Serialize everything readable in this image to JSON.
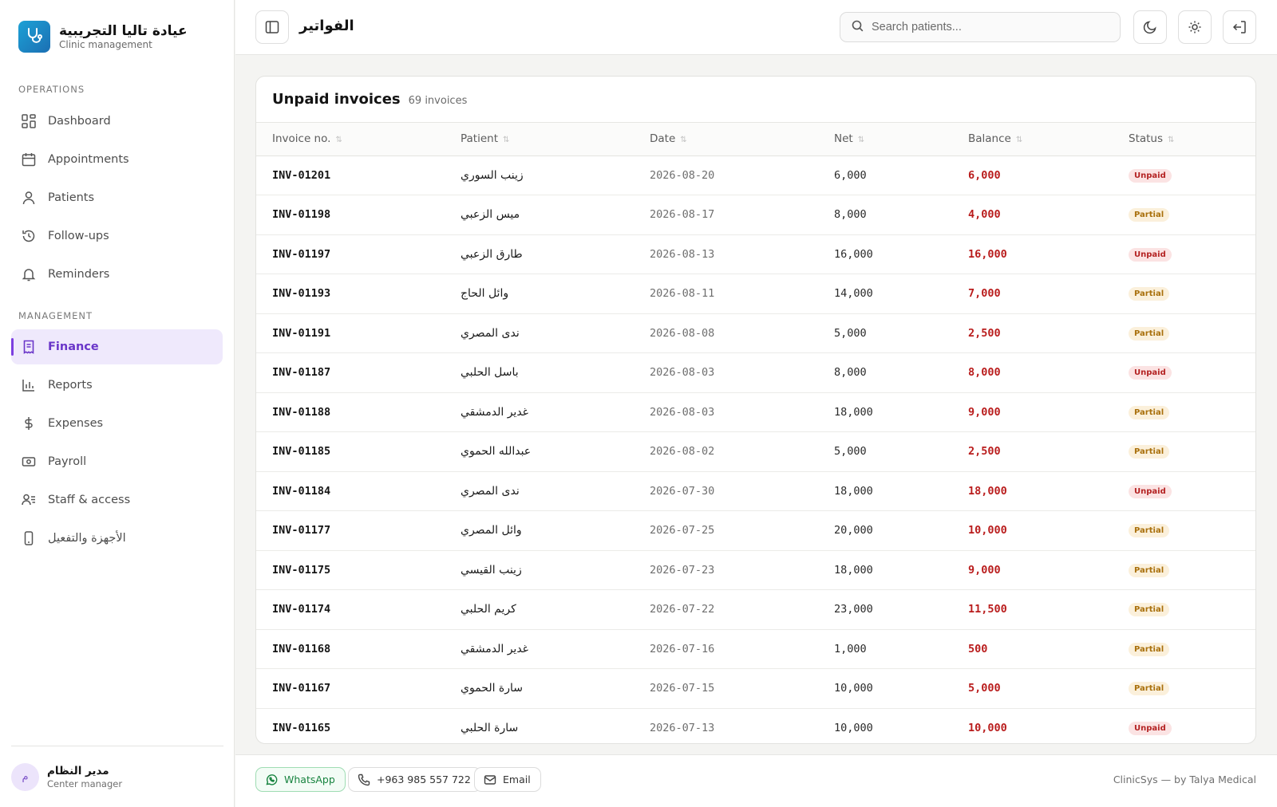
{
  "brand": {
    "title": "عيادة تاليا التجريبية",
    "subtitle": "Clinic management"
  },
  "sidebar": {
    "sections": [
      {
        "label": "OPERATIONS",
        "items": [
          {
            "label": "Dashboard",
            "icon": "dashboard-icon"
          },
          {
            "label": "Appointments",
            "icon": "calendar-icon"
          },
          {
            "label": "Patients",
            "icon": "user-icon"
          },
          {
            "label": "Follow-ups",
            "icon": "history-icon"
          },
          {
            "label": "Reminders",
            "icon": "bell-icon"
          }
        ]
      },
      {
        "label": "MANAGEMENT",
        "items": [
          {
            "label": "Finance",
            "icon": "receipt-icon",
            "active": true
          },
          {
            "label": "Reports",
            "icon": "bar-chart-icon"
          },
          {
            "label": "Expenses",
            "icon": "dollar-icon"
          },
          {
            "label": "Payroll",
            "icon": "banknote-icon"
          },
          {
            "label": "Staff & access",
            "icon": "staff-icon"
          },
          {
            "label": "الأجهزة والتفعيل",
            "icon": "phone-device-icon"
          }
        ]
      }
    ]
  },
  "user": {
    "initial": "م",
    "name": "مدير النظام",
    "role": "Center manager"
  },
  "header": {
    "title": "الفواتير",
    "search_placeholder": "Search patients..."
  },
  "card": {
    "title": "Unpaid invoices",
    "count": "69 invoices"
  },
  "table": {
    "columns": [
      "Invoice no.",
      "Patient",
      "Date",
      "Net",
      "Balance",
      "Status"
    ],
    "rows": [
      {
        "invoice": "INV-01201",
        "patient": "زينب السوري",
        "date": "2026-08-20",
        "net": "6,000",
        "balance": "6,000",
        "status": "Unpaid"
      },
      {
        "invoice": "INV-01198",
        "patient": "ميس الزعبي",
        "date": "2026-08-17",
        "net": "8,000",
        "balance": "4,000",
        "status": "Partial"
      },
      {
        "invoice": "INV-01197",
        "patient": "طارق الزعبي",
        "date": "2026-08-13",
        "net": "16,000",
        "balance": "16,000",
        "status": "Unpaid"
      },
      {
        "invoice": "INV-01193",
        "patient": "وائل الحاج",
        "date": "2026-08-11",
        "net": "14,000",
        "balance": "7,000",
        "status": "Partial"
      },
      {
        "invoice": "INV-01191",
        "patient": "ندى المصري",
        "date": "2026-08-08",
        "net": "5,000",
        "balance": "2,500",
        "status": "Partial"
      },
      {
        "invoice": "INV-01187",
        "patient": "باسل الحلبي",
        "date": "2026-08-03",
        "net": "8,000",
        "balance": "8,000",
        "status": "Unpaid"
      },
      {
        "invoice": "INV-01188",
        "patient": "غدير الدمشقي",
        "date": "2026-08-03",
        "net": "18,000",
        "balance": "9,000",
        "status": "Partial"
      },
      {
        "invoice": "INV-01185",
        "patient": "عبدالله الحموي",
        "date": "2026-08-02",
        "net": "5,000",
        "balance": "2,500",
        "status": "Partial"
      },
      {
        "invoice": "INV-01184",
        "patient": "ندى المصري",
        "date": "2026-07-30",
        "net": "18,000",
        "balance": "18,000",
        "status": "Unpaid"
      },
      {
        "invoice": "INV-01177",
        "patient": "وائل المصري",
        "date": "2026-07-25",
        "net": "20,000",
        "balance": "10,000",
        "status": "Partial"
      },
      {
        "invoice": "INV-01175",
        "patient": "زينب القيسي",
        "date": "2026-07-23",
        "net": "18,000",
        "balance": "9,000",
        "status": "Partial"
      },
      {
        "invoice": "INV-01174",
        "patient": "كريم الحلبي",
        "date": "2026-07-22",
        "net": "23,000",
        "balance": "11,500",
        "status": "Partial"
      },
      {
        "invoice": "INV-01168",
        "patient": "غدير الدمشقي",
        "date": "2026-07-16",
        "net": "1,000",
        "balance": "500",
        "status": "Partial"
      },
      {
        "invoice": "INV-01167",
        "patient": "سارة الحموي",
        "date": "2026-07-15",
        "net": "10,000",
        "balance": "5,000",
        "status": "Partial"
      },
      {
        "invoice": "INV-01165",
        "patient": "سارة الحلبي",
        "date": "2026-07-13",
        "net": "10,000",
        "balance": "10,000",
        "status": "Unpaid"
      }
    ]
  },
  "footer": {
    "whatsapp": "WhatsApp",
    "phone": "+963 985 557 722",
    "email": "Email",
    "credit": "ClinicSys — by Talya Medical"
  },
  "colors": {
    "accent": "#7c3fe0",
    "balance": "#b91c1c",
    "unpaid_bg": "#fbe3e3",
    "partial_bg": "#fbf0db",
    "whatsapp": "#17833f"
  }
}
